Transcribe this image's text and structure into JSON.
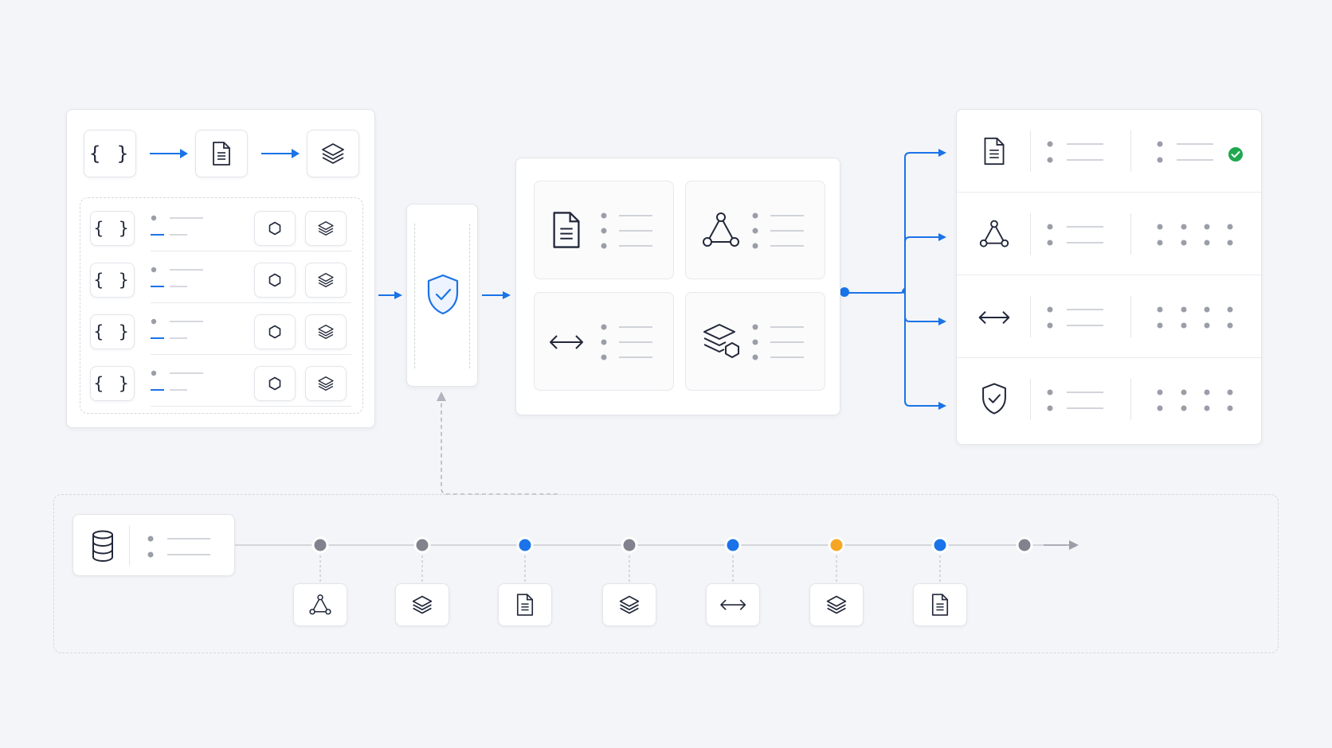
{
  "diagram": {
    "accent_color": "#1a73e8",
    "neutral_node_color": "#80838d",
    "warning_node_color": "#f5a623",
    "success_color": "#1fa84f",
    "ingest_panel": {
      "header_flow": [
        "code-braces-icon",
        "document-icon",
        "layers-icon"
      ],
      "rows": [
        {
          "icons": [
            "code-braces-icon",
            "hexagon-icon",
            "layers-icon"
          ]
        },
        {
          "icons": [
            "code-braces-icon",
            "hexagon-icon",
            "layers-icon"
          ]
        },
        {
          "icons": [
            "code-braces-icon",
            "hexagon-icon",
            "layers-icon"
          ]
        },
        {
          "icons": [
            "code-braces-icon",
            "hexagon-icon",
            "layers-icon"
          ]
        }
      ]
    },
    "validation_gate": {
      "icon": "shield-check-icon"
    },
    "processing_grid": {
      "cards": [
        {
          "icon": "document-icon"
        },
        {
          "icon": "graph-triangle-icon"
        },
        {
          "icon": "arrows-horizontal-icon"
        },
        {
          "icon": "layers-hexagon-icon"
        }
      ]
    },
    "output_panel": {
      "rows": [
        {
          "icon": "document-icon",
          "status": "success-check-icon"
        },
        {
          "icon": "graph-triangle-icon",
          "status": "dot-grid"
        },
        {
          "icon": "arrows-horizontal-icon",
          "status": "dot-grid"
        },
        {
          "icon": "shield-check-icon",
          "status": "dot-grid"
        }
      ]
    },
    "timeline": {
      "source_icon": "database-icon",
      "nodes": [
        {
          "state": "neutral",
          "icon": "graph-triangle-icon"
        },
        {
          "state": "neutral",
          "icon": "layers-icon"
        },
        {
          "state": "active",
          "icon": "document-icon"
        },
        {
          "state": "neutral",
          "icon": "layers-icon"
        },
        {
          "state": "active",
          "icon": "arrows-horizontal-icon"
        },
        {
          "state": "warning",
          "icon": "layers-icon"
        },
        {
          "state": "active",
          "icon": "document-icon"
        },
        {
          "state": "neutral",
          "icon": null
        }
      ]
    }
  }
}
